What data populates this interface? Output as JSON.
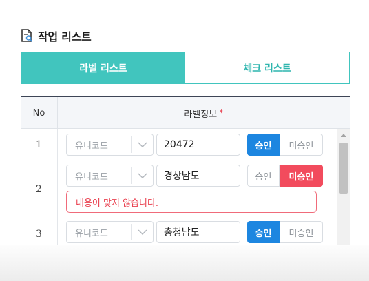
{
  "page": {
    "title": "작업 리스트",
    "title_icon": "document-search-icon"
  },
  "tabs": [
    {
      "label": "라벨 리스트",
      "active": true
    },
    {
      "label": "체크 리스트",
      "active": false
    }
  ],
  "table": {
    "headers": {
      "no": "No",
      "label_info": "라벨정보",
      "required_mark": "*"
    },
    "rows": [
      {
        "no": "1",
        "type": "유니코드",
        "value": "20472",
        "approve": "승인",
        "reject": "미승인",
        "status": "approved",
        "error": ""
      },
      {
        "no": "2",
        "type": "유니코드",
        "value": "경상남도",
        "approve": "승인",
        "reject": "미승인",
        "status": "rejected",
        "error": "내용이 맞지 않습니다."
      },
      {
        "no": "3",
        "type": "유니코드",
        "value": "충청남도",
        "approve": "승인",
        "reject": "미승인",
        "status": "approved",
        "error": ""
      }
    ]
  },
  "colors": {
    "accent": "#41c5be",
    "approve": "#1d86e0",
    "reject": "#f24b5d",
    "header_border": "#3d4556"
  }
}
